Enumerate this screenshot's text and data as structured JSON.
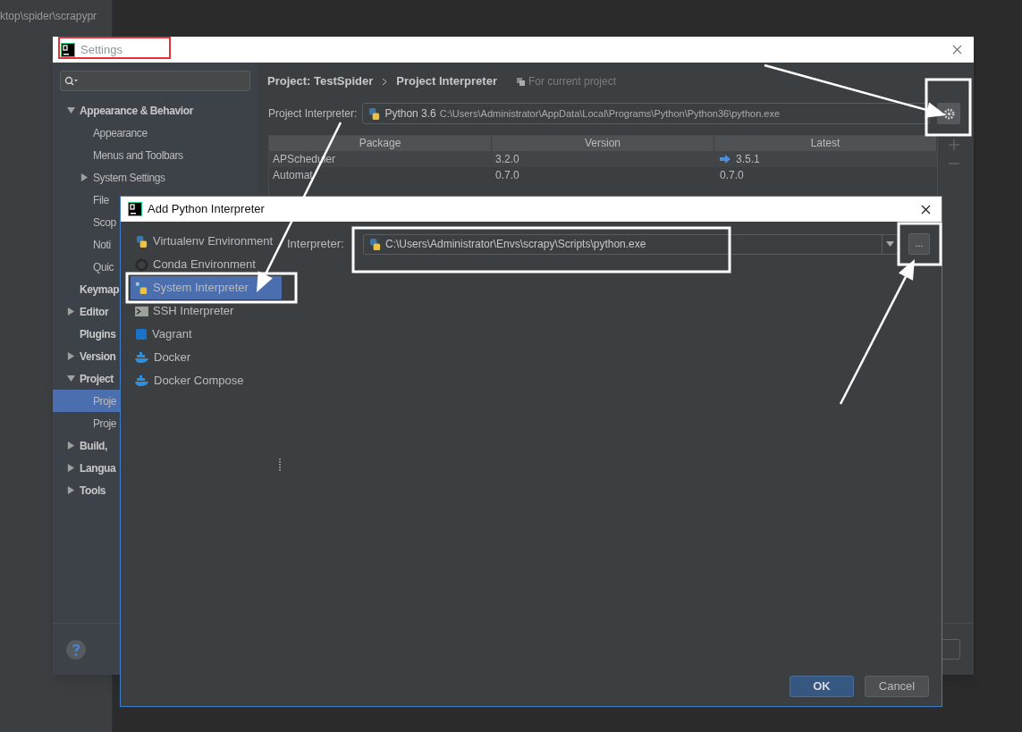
{
  "background": {
    "path_text": "ktop\\spider\\scrapypr"
  },
  "settings": {
    "title": "Settings",
    "sidebar": [
      {
        "label": "Appearance & Behavior",
        "bold": true,
        "expanded": true,
        "selected": false,
        "children": [
          {
            "label": "Appearance",
            "selected": false
          },
          {
            "label": "Menus and Toolbars",
            "selected": false
          },
          {
            "label": "System Settings",
            "expanded": false,
            "selected": false
          },
          {
            "label": "File",
            "selected": false
          },
          {
            "label": "Scop",
            "selected": false
          },
          {
            "label": "Noti",
            "selected": false
          },
          {
            "label": "Quic",
            "selected": false
          }
        ]
      },
      {
        "label": "Keymap",
        "bold": true,
        "selected": false
      },
      {
        "label": "Editor",
        "bold": true,
        "expanded": false,
        "selected": false
      },
      {
        "label": "Plugins",
        "bold": true,
        "selected": false
      },
      {
        "label": "Version",
        "bold": true,
        "expanded": false,
        "selected": false
      },
      {
        "label": "Project",
        "bold": true,
        "expanded": true,
        "selected": false,
        "children": [
          {
            "label": "Proje",
            "selected": true
          },
          {
            "label": "Proje",
            "selected": false
          }
        ]
      },
      {
        "label": "Build,",
        "bold": true,
        "expanded": false,
        "selected": false
      },
      {
        "label": "Langua",
        "bold": true,
        "expanded": false,
        "selected": false
      },
      {
        "label": "Tools",
        "bold": true,
        "expanded": false,
        "selected": false
      }
    ],
    "breadcrumb": [
      "Project: TestSpider",
      "Project Interpreter"
    ],
    "scope_note": "For current project",
    "interpreter": {
      "label": "Project Interpreter:",
      "name": "Python 3.6",
      "path": "C:\\Users\\Administrator\\AppData\\Local\\Programs\\Python\\Python36\\python.exe"
    },
    "table": {
      "columns": [
        "Package",
        "Version",
        "Latest"
      ],
      "rows": [
        {
          "package": "APScheduler",
          "version": "3.2.0",
          "latest": "3.5.1",
          "upgrade": true
        },
        {
          "package": "Automat",
          "version": "0.7.0",
          "latest": "0.7.0",
          "upgrade": false
        }
      ]
    }
  },
  "add_dialog": {
    "title": "Add Python Interpreter",
    "items": [
      {
        "label": "Virtualenv Environment",
        "kind": "python",
        "selected": false
      },
      {
        "label": "Conda Environment",
        "kind": "conda",
        "selected": false
      },
      {
        "label": "System Interpreter",
        "kind": "system",
        "selected": true
      },
      {
        "label": "SSH Interpreter",
        "kind": "ssh",
        "selected": false
      },
      {
        "label": "Vagrant",
        "kind": "vagrant",
        "selected": false
      },
      {
        "label": "Docker",
        "kind": "docker",
        "selected": false
      },
      {
        "label": "Docker Compose",
        "kind": "docker",
        "selected": false
      }
    ],
    "interpreter_label": "Interpreter:",
    "interpreter_path": "C:\\Users\\Administrator\\Envs\\scrapy\\Scripts\\python.exe",
    "browse": "...",
    "buttons": [
      {
        "label": "OK",
        "kind": "primary"
      },
      {
        "label": "Cancel",
        "kind": "secondary"
      }
    ]
  }
}
